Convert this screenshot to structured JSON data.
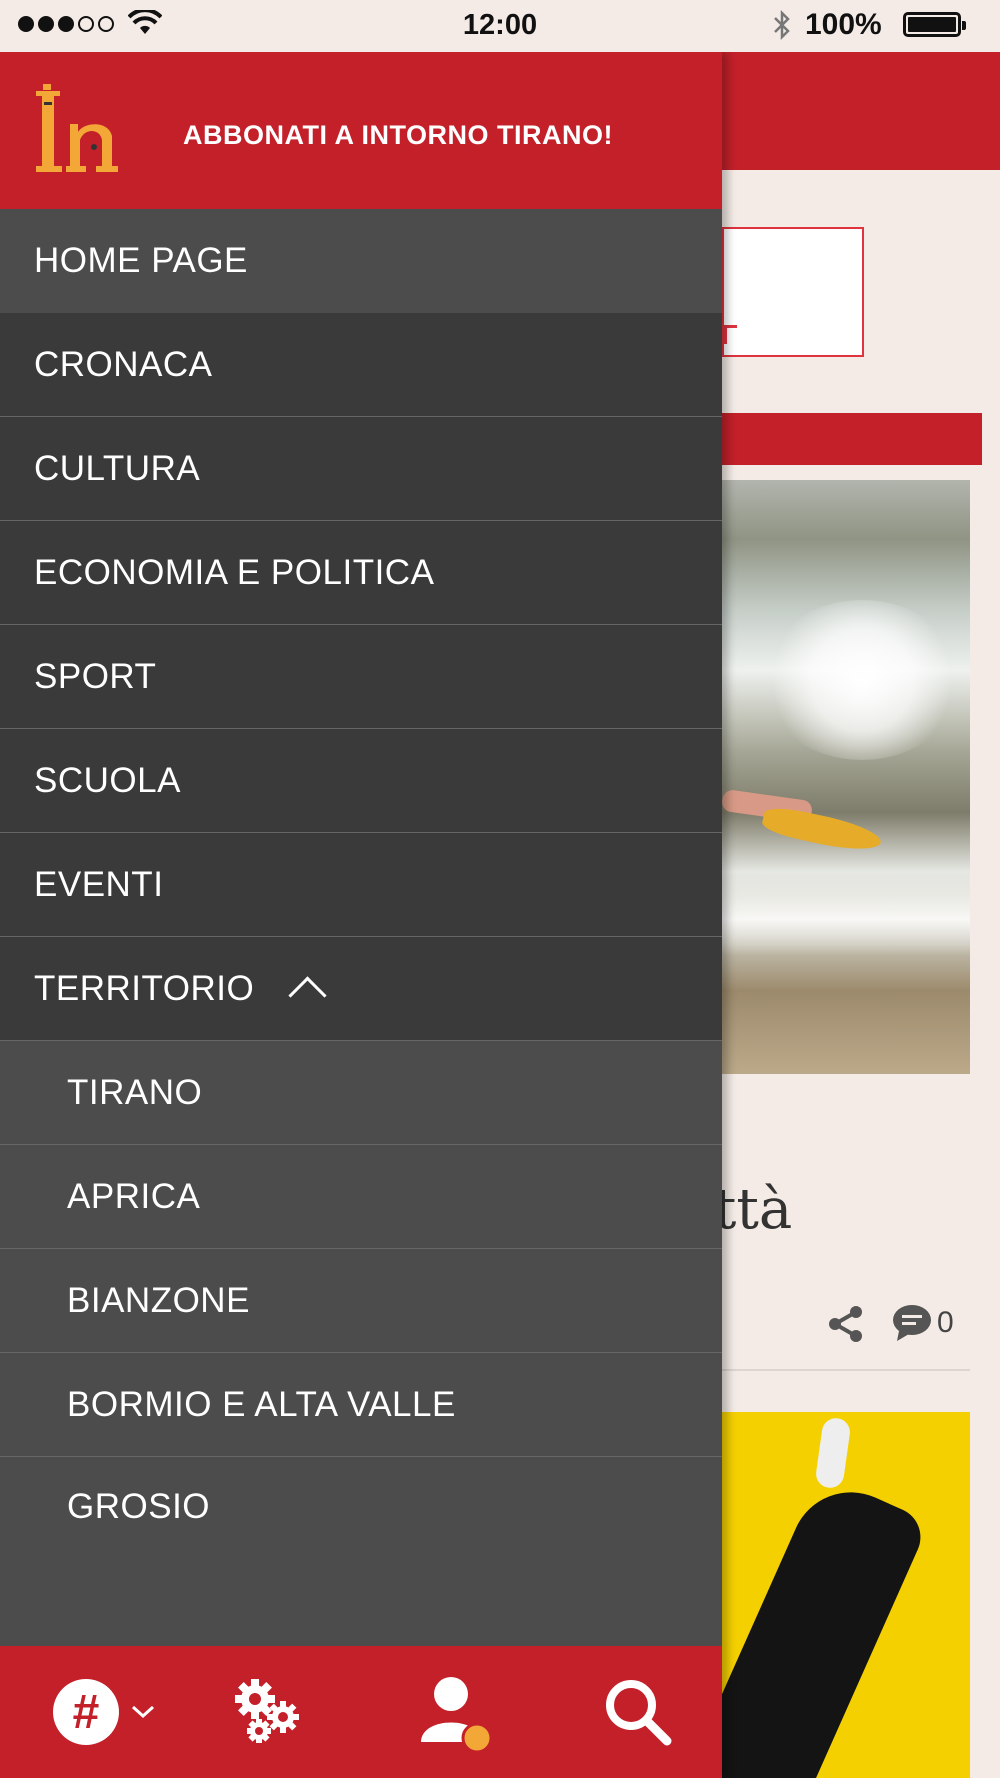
{
  "status_bar": {
    "time": "12:00",
    "battery_percent": "100%",
    "signal_bars": 3,
    "icons": [
      "wifi-icon",
      "bluetooth-icon",
      "battery-icon"
    ]
  },
  "drawer": {
    "subscribe_label": "ABBONATI A INTORNO TIRANO!",
    "logo_text": "In",
    "menu": [
      {
        "label": "HOME PAGE",
        "active": true
      },
      {
        "label": "CRONACA"
      },
      {
        "label": "CULTURA"
      },
      {
        "label": "ECONOMIA E POLITICA"
      },
      {
        "label": "SPORT"
      },
      {
        "label": "SCUOLA"
      },
      {
        "label": "EVENTI"
      },
      {
        "label": "TERRITORIO",
        "expanded": true
      }
    ],
    "territorio_items": [
      {
        "label": "TIRANO"
      },
      {
        "label": "APRICA"
      },
      {
        "label": "BIANZONE"
      },
      {
        "label": "BORMIO E ALTA VALLE"
      },
      {
        "label": "GROSIO"
      }
    ],
    "toolbar": {
      "icons": [
        "hashtag-icon",
        "settings-icon",
        "user-icon",
        "search-icon"
      ]
    }
  },
  "background_page": {
    "title_fragment": "ittà",
    "comment_count": "0"
  },
  "colors": {
    "brand_red": "#c3202a",
    "menu_dark": "#3a3a3a",
    "menu_light": "#4c4c4c",
    "logo_yellow": "#f3a737",
    "notification_orange": "#f3a737"
  }
}
